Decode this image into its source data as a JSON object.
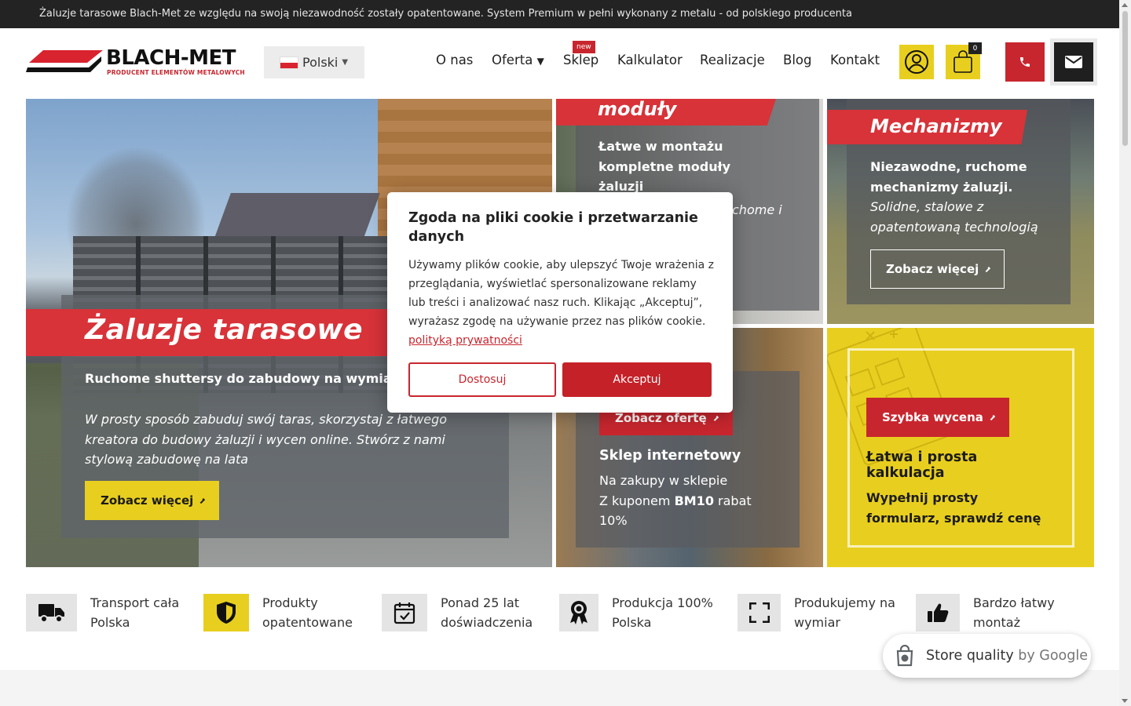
{
  "topbar": {
    "text": "Żaluzje tarasowe Blach-Met ze względu na swoją niezawodność zostały opatentowane. System Premium w pełni wykonany z metalu - od polskiego producenta"
  },
  "logo": {
    "name": "BLACH-MET",
    "tagline": "PRODUCENT ELEMENTÓW METALOWYCH"
  },
  "language": {
    "label": "Polski"
  },
  "nav": {
    "items": [
      "O nas",
      "Oferta",
      "Sklep",
      "Kalkulator",
      "Realizacje",
      "Blog",
      "Kontakt"
    ],
    "shop_badge": "new",
    "offer_caret": "▼"
  },
  "cart": {
    "count": "0"
  },
  "hero": {
    "main": {
      "title": "Żaluzje tarasowe",
      "lead": "Ruchome shuttersy do zabudowy na wymiar Premium.",
      "desc": "W prosty sposób zabuduj swój taras, skorzystaj z łatwego kreatora do budowy żaluzji i wycen online. Stwórz z nami stylową zabudowę na lata",
      "button": "Zobacz więcej"
    },
    "modules": {
      "title": "moduły",
      "lead": "Łatwe w montażu kompletne moduły żaluzji",
      "desc": "chome i"
    },
    "mechanisms": {
      "title": "Mechanizmy",
      "lead": "Niezawodne, ruchome mechanizmy żaluzji.",
      "desc": "Solidne, stalowe z opatentowaną technologią",
      "button": "Zobacz więcej"
    },
    "shop": {
      "button": "Zobacz ofertę",
      "title": "Sklep internetowy",
      "line1": "Na zakupy w sklepie",
      "line2_pre": "Z kuponem ",
      "coupon": "BM10",
      "line2_post": " rabat",
      "line3": "10%"
    },
    "calc": {
      "button": "Szybka wycena",
      "title": "Łatwa i prosta kalkulacja",
      "desc": "Wypełnij prosty formularz, sprawdź cenę"
    }
  },
  "features": [
    {
      "icon": "truck-icon",
      "text": "Transport cała Polska"
    },
    {
      "icon": "shield-icon",
      "text": "Produkty opatentowane"
    },
    {
      "icon": "calendar-check-icon",
      "text": "Ponad 25 lat doświadczenia"
    },
    {
      "icon": "award-icon",
      "text": "Produkcja 100% Polska"
    },
    {
      "icon": "expand-icon",
      "text": "Produkujemy na wymiar"
    },
    {
      "icon": "thumbs-up-icon",
      "text": "Bardzo łatwy montaż"
    }
  ],
  "cookie": {
    "title": "Zgoda na pliki cookie i przetwarzanie danych",
    "body": "Używamy plików cookie, aby ulepszyć Twoje wrażenia z przeglądania, wyświetlać spersonalizowane reklamy lub treści i analizować nasz ruch. Klikając „Akceptuj”, wyrażasz zgodę na używanie przez nas plików cookie.",
    "link": "polityką prywatności",
    "customize": "Dostosuj",
    "accept": "Akceptuj"
  },
  "google_badge": {
    "text": "Store quality",
    "by": "by Google"
  },
  "colors": {
    "brand_red": "#c8262e",
    "brand_yellow": "#e8cf1f",
    "dark": "#232323"
  }
}
